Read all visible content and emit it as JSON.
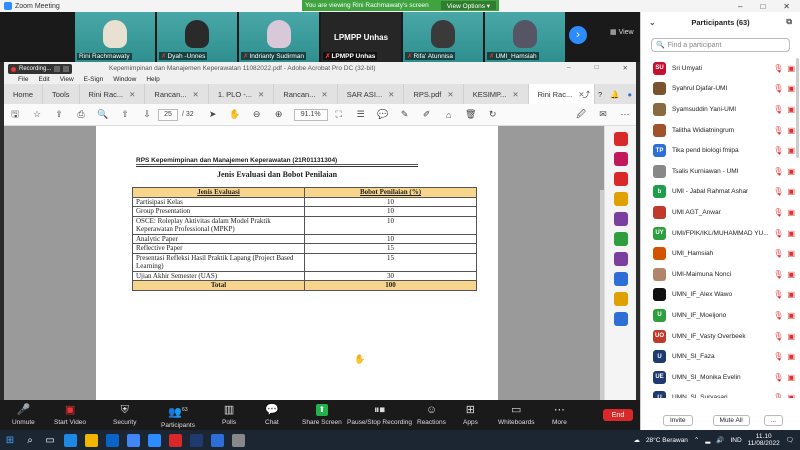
{
  "zoom_window": {
    "title": "Zoom Meeting",
    "banner_text": "You are viewing Rini Rachmawaty's screen",
    "view_options": "View Options ▾"
  },
  "video_strip": {
    "tiles": [
      {
        "name": "Rini Rachmawaty",
        "muted": false
      },
      {
        "name": "Dyah -Unnes",
        "muted": true
      },
      {
        "name": "Indrianty Sudirman",
        "muted": true
      },
      {
        "name": "LPMPP Unhas",
        "muted": true,
        "display_name": "LPMPP Unhas"
      },
      {
        "name": "Rifa' Atunnisa",
        "muted": true
      },
      {
        "name": "UMI_Hamsiah",
        "muted": true
      }
    ],
    "view_label": "View"
  },
  "recording": {
    "label": "Recording..."
  },
  "acrobat": {
    "title": "Kepemimpinan dan Manajemen Keperawatan 11082022.pdf - Adobe Acrobat Pro DC (32-bit)",
    "menu": [
      "File",
      "Edit",
      "View",
      "E-Sign",
      "Window",
      "Help"
    ],
    "tabs": [
      "Home",
      "Tools",
      "Rini Rac...",
      "Rancan...",
      "1. PLO -...",
      "Rancan...",
      "SAR ASI...",
      "RPS.pdf",
      "KESIMP...",
      "Rini Rac..."
    ],
    "page_current": "25",
    "page_total": "/ 32",
    "zoom": "91.1%"
  },
  "document": {
    "header": "RPS Kepemimpinan dan Manajemen Keperawatan (21R01131304)",
    "title": "Jenis Evaluasi dan Bobot Penilaian",
    "columns": [
      "Jenis Evaluasi",
      "Bobot Penilaian (%)"
    ],
    "rows": [
      {
        "item": "Partisipasi Kelas",
        "value": "10"
      },
      {
        "item": "Group Presentation",
        "value": "10"
      },
      {
        "item": "OSCE: Roleplay Aktivitas dalam Model Praktik Keperawatan Professional (MPKP)",
        "value": "10"
      },
      {
        "item": "Analytic Paper",
        "value": "10"
      },
      {
        "item": "Reflective Paper",
        "value": "15"
      },
      {
        "item": "Presentasi Refleksi Hasil Praktik Lapang (Project Based Learning)",
        "value": "15"
      },
      {
        "item": "Ujian Akhir Semester (UAS)",
        "value": "30"
      }
    ],
    "total_label": "Total",
    "total_value": "100"
  },
  "zoom_toolbar": {
    "unmute": "Unmute",
    "start_video": "Start Video",
    "security": "Security",
    "participants": "Participants",
    "participants_count": "63",
    "polls": "Polls",
    "chat": "Chat",
    "share_screen": "Share Screen",
    "pause_recording": "Pause/Stop Recording",
    "reactions": "Reactions",
    "apps": "Apps",
    "whiteboards": "Whiteboards",
    "more": "More",
    "end": "End"
  },
  "participants_panel": {
    "title": "Participants (63)",
    "search_placeholder": "Find a participant",
    "invite": "Invite",
    "mute_all": "Mute All",
    "more": "...",
    "people": [
      {
        "initials": "SU",
        "name": "Sri Umyati",
        "color": "#c8102e"
      },
      {
        "initials": "",
        "name": "Syahrul Djafar-UMI",
        "color": "#7a5230"
      },
      {
        "initials": "",
        "name": "Syamsuddin Yani-UMI",
        "color": "#8a6a40"
      },
      {
        "initials": "",
        "name": "Talitha Widiatningrum",
        "color": "#a0522d"
      },
      {
        "initials": "TP",
        "name": "Tika pend biologi fmipa",
        "color": "#2d6fd6"
      },
      {
        "initials": "",
        "name": "Tsalis Kurniawan - UMI",
        "color": "#888888"
      },
      {
        "initials": "b",
        "name": "UMI - Jabal Rahmat Ashar",
        "color": "#1e9e4a"
      },
      {
        "initials": "",
        "name": "UMI AGT_Anwar",
        "color": "#c0392b"
      },
      {
        "initials": "UY",
        "name": "UMI/FPIK/IKL/MUHAMMAD YU...",
        "color": "#2e9e3e"
      },
      {
        "initials": "",
        "name": "UMI_Hamsiah",
        "color": "#d35400"
      },
      {
        "initials": "",
        "name": "UMI-Maimuna Nonci",
        "color": "#b0856a"
      },
      {
        "initials": "",
        "name": "UMN_IF_Alex Wawo",
        "color": "#111111"
      },
      {
        "initials": "U",
        "name": "UMN_IF_Moeljono",
        "color": "#2e9e3e"
      },
      {
        "initials": "UO",
        "name": "UMN_IF_Vasty Overbeek",
        "color": "#c0392b"
      },
      {
        "initials": "U",
        "name": "UMN_SI_Faza",
        "color": "#1f3a6e"
      },
      {
        "initials": "UE",
        "name": "UMN_SI_Monika Evelin",
        "color": "#1f3a6e"
      },
      {
        "initials": "U",
        "name": "UMN_SI_Suryasari",
        "color": "#1f3a6e"
      }
    ]
  },
  "taskbar": {
    "weather": "28°C  Berawan",
    "lang": "IND",
    "time": "11.10",
    "date": "11/08/2022"
  }
}
